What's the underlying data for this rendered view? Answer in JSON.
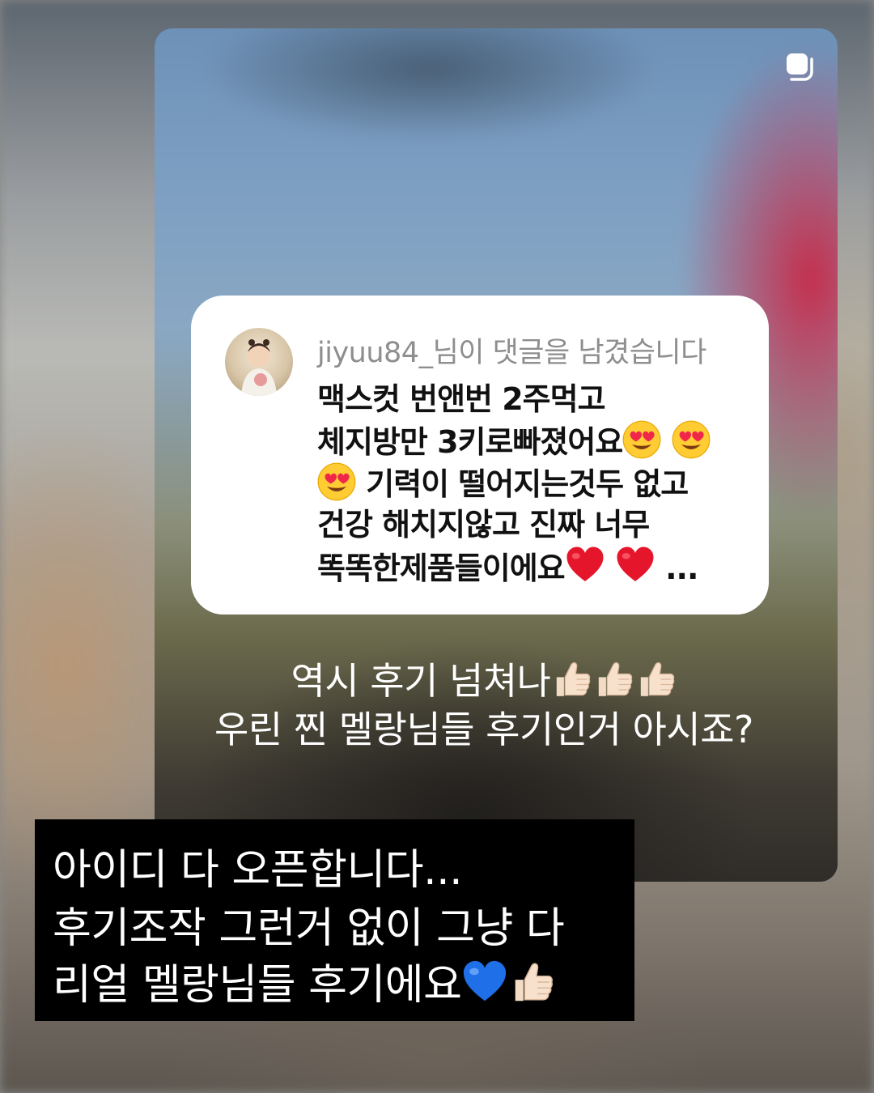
{
  "question_sticker": {
    "username_line": "jiyuu84_님이 댓글을 남겼습니다",
    "comment": {
      "line1": "맥스컷 번앤번 2주먹고",
      "line2": "체지방만 3키로빠졌어요",
      "line3": "기력이 떨어지는것두 없고",
      "line4": "건강 해치지않고 진짜 너무",
      "line5": "똑똑한제품들이에요",
      "ellipsis": "..."
    }
  },
  "caption": {
    "line1": "역시 후기 넘쳐나",
    "line2": "우린 찐 멜랑님들 후기인거 아시죠?"
  },
  "overlay_text": {
    "line1": "아이디 다 오픈합니다...",
    "line2": "후기조작 그런거 없이 그냥 다",
    "line3": "리얼 멜랑님들 후기에요"
  },
  "icons": {
    "multi_story": "multiple-images-icon",
    "heart_eyes": "heart-eyes-emoji",
    "red_heart": "red-heart-emoji",
    "thumbs_up": "thumbs-up-emoji",
    "blue_heart": "blue-heart-emoji"
  },
  "colors": {
    "sticker_bg": "#ffffff",
    "username_gray": "#8e8e8e",
    "comment_text": "#111111",
    "caption_text": "#ffffff",
    "textbox_bg": "#000000"
  }
}
